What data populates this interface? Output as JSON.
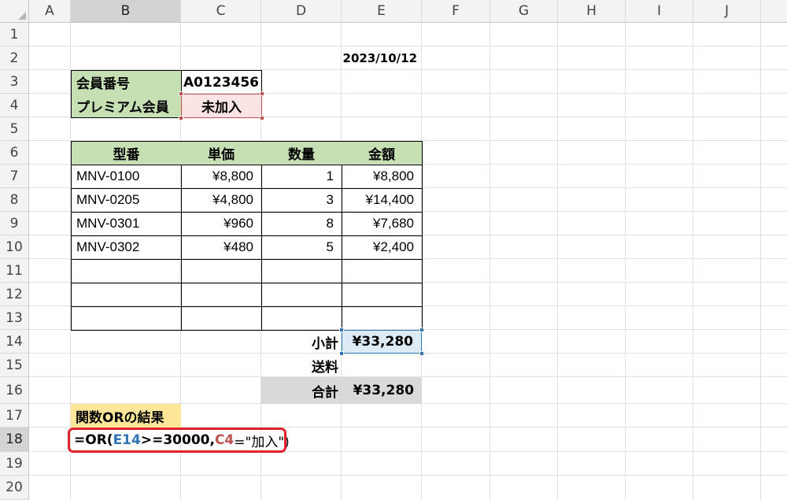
{
  "columns": [
    "A",
    "B",
    "C",
    "D",
    "E",
    "F",
    "G",
    "H",
    "I",
    "J"
  ],
  "rows": [
    "1",
    "2",
    "3",
    "4",
    "5",
    "6",
    "7",
    "8",
    "9",
    "10",
    "11",
    "12",
    "13",
    "14",
    "15",
    "16",
    "17",
    "18",
    "19",
    "20"
  ],
  "date": "2023/10/12",
  "member": {
    "id_label": "会員番号",
    "id_value": "A0123456",
    "premium_label": "プレミアム会員",
    "premium_value": "未加入"
  },
  "table": {
    "headers": [
      "型番",
      "単価",
      "数量",
      "金額"
    ],
    "rows": [
      [
        "MNV-0100",
        "¥8,800",
        "1",
        "¥8,800"
      ],
      [
        "MNV-0205",
        "¥4,800",
        "3",
        "¥14,400"
      ],
      [
        "MNV-0301",
        "¥960",
        "8",
        "¥7,680"
      ],
      [
        "MNV-0302",
        "¥480",
        "5",
        "¥2,400"
      ]
    ]
  },
  "summary": {
    "subtotal_label": "小計",
    "subtotal_value": "¥33,280",
    "shipping_label": "送料",
    "shipping_value": "",
    "total_label": "合計",
    "total_value": "¥33,280"
  },
  "result_label": "関数ORの結果",
  "formula": {
    "prefix": "=OR(",
    "ref1": "E14",
    "middle": ">=30000,",
    "ref2": "C4",
    "suffix": "=\"加入\")"
  },
  "colors": {
    "ref1": "#2f75b5",
    "ref2": "#c0504d",
    "highlight": "#e0222e"
  }
}
